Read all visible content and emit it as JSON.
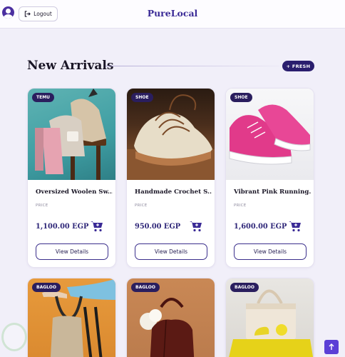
{
  "header": {
    "brand": "PureLocal",
    "logout_label": "Logout"
  },
  "section": {
    "title": "New Arrivals",
    "badge": "+ FRESH"
  },
  "products": [
    {
      "brand": "TEMU",
      "name": "Oversized Woolen Sw...",
      "price_label": "PRICE",
      "price": "1,100.00 EGP",
      "button": "View Details"
    },
    {
      "brand": "SHOE",
      "name": "Handmade Crochet S...",
      "price_label": "PRICE",
      "price": "950.00 EGP",
      "button": "View Details"
    },
    {
      "brand": "SHOE",
      "name": "Vibrant Pink Running...",
      "price_label": "PRICE",
      "price": "1,600.00 EGP",
      "button": "View Details"
    },
    {
      "brand": "BAGLOO"
    },
    {
      "brand": "BAGLOO"
    },
    {
      "brand": "BAGLOO"
    }
  ],
  "colors": {
    "accent": "#3a2a96",
    "badge_bg": "#2a1e5e",
    "page_bg": "#f1eff9",
    "scroll_button": "#5b3fd6"
  },
  "icons": {
    "user": "user-avatar-icon",
    "logout": "logout-icon",
    "cart": "add-to-cart-icon",
    "scroll": "arrow-up-icon"
  }
}
